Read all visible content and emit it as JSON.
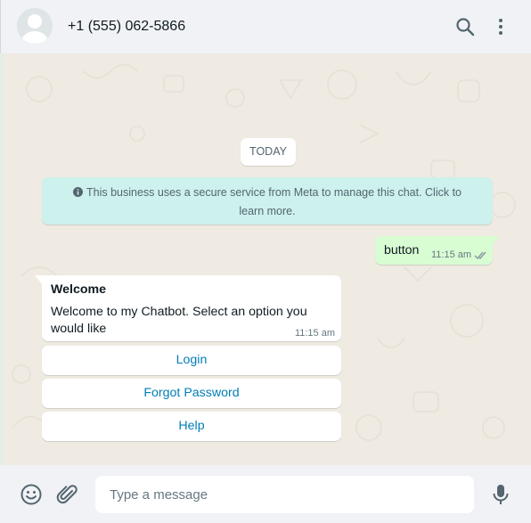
{
  "header": {
    "contact_name": "+1 (555) 062-5866",
    "icons": [
      "avatar",
      "search-icon",
      "menu-icon"
    ]
  },
  "chat": {
    "date_chip": "TODAY",
    "system_message": "This business uses a secure service from Meta to manage this chat. Click to learn more.",
    "outgoing": {
      "text": "button",
      "time": "11:15 am",
      "status": "read"
    },
    "incoming": {
      "title": "Welcome",
      "body": "Welcome to my Chatbot. Select an option you would like",
      "time": "11:15 am"
    },
    "reply_buttons": [
      {
        "label": "Login"
      },
      {
        "label": "Forgot Password"
      },
      {
        "label": "Help"
      }
    ]
  },
  "footer": {
    "placeholder": "Type a message",
    "icons": [
      "emoji-icon",
      "attach-icon",
      "mic-icon"
    ]
  },
  "colors": {
    "header_bg": "#f0f2f5",
    "chat_bg": "#efeae2",
    "outgoing_bubble": "#d9fdd3",
    "system_bubble": "#cdf1ec",
    "link": "#027eb5",
    "read_ticks": "#8696a0"
  }
}
